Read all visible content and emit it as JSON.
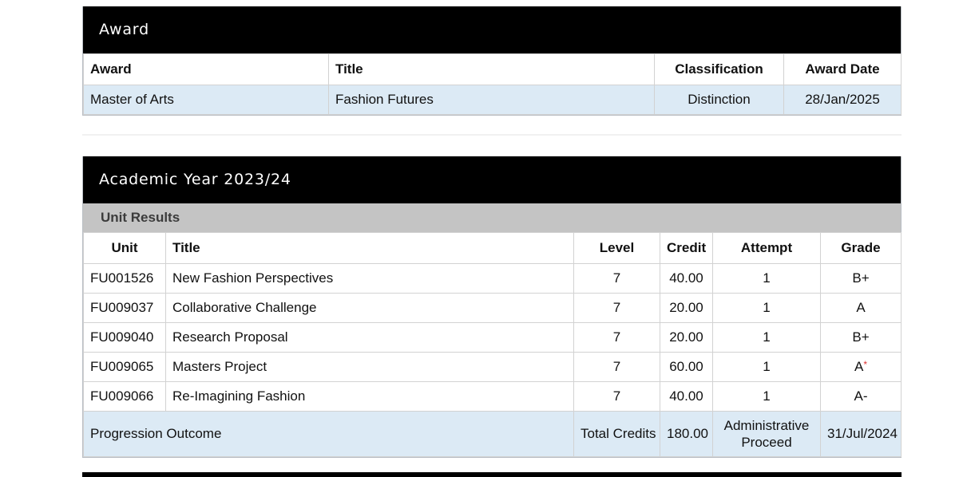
{
  "award_panel": {
    "title": "Award",
    "headers": {
      "award": "Award",
      "title": "Title",
      "classification": "Classification",
      "award_date": "Award Date"
    },
    "row": {
      "award": "Master of Arts",
      "title": "Fashion Futures",
      "classification": "Distinction",
      "award_date": "28/Jan/2025"
    }
  },
  "year_panel": {
    "title": "Academic Year 2023/24",
    "subhead": "Unit Results",
    "headers": {
      "unit": "Unit",
      "title": "Title",
      "level": "Level",
      "credit": "Credit",
      "attempt": "Attempt",
      "grade": "Grade"
    },
    "rows": [
      {
        "unit": "FU001526",
        "title": "New Fashion Perspectives",
        "level": "7",
        "credit": "40.00",
        "attempt": "1",
        "grade": "B+"
      },
      {
        "unit": "FU009037",
        "title": "Collaborative Challenge",
        "level": "7",
        "credit": "20.00",
        "attempt": "1",
        "grade": "A"
      },
      {
        "unit": "FU009040",
        "title": "Research Proposal",
        "level": "7",
        "credit": "20.00",
        "attempt": "1",
        "grade": "B+"
      },
      {
        "unit": "FU009065",
        "title": "Masters Project",
        "level": "7",
        "credit": "60.00",
        "attempt": "1",
        "grade": "A",
        "grade_mark": "*"
      },
      {
        "unit": "FU009066",
        "title": "Re-Imagining Fashion",
        "level": "7",
        "credit": "40.00",
        "attempt": "1",
        "grade": "A-"
      }
    ],
    "outcome": {
      "label": "Progression Outcome",
      "total_label": "Total Credits",
      "total_value": "180.00",
      "decision": "Administrative Proceed",
      "date": "31/Jul/2024"
    }
  }
}
